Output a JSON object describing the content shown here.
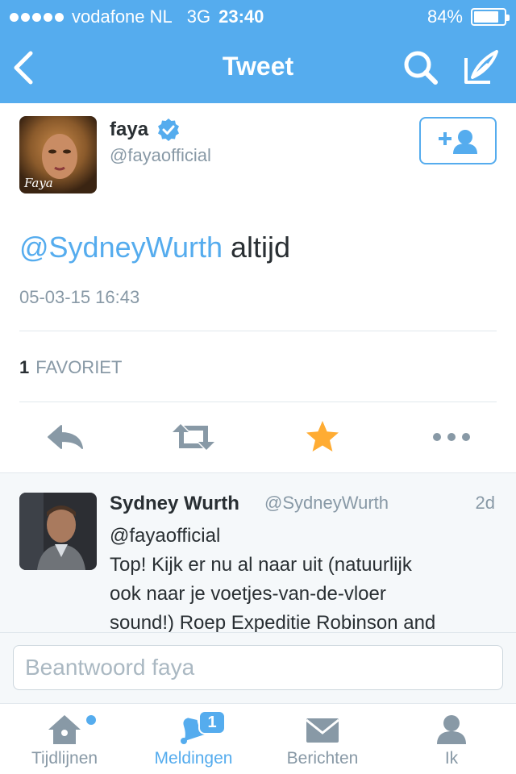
{
  "status_bar": {
    "carrier": "vodafone NL",
    "network": "3G",
    "time": "23:40",
    "battery_percent_label": "84%",
    "battery_level": 0.84
  },
  "nav": {
    "title": "Tweet",
    "icons": [
      "chevron-left-icon",
      "search-icon",
      "compose-icon"
    ]
  },
  "tweet": {
    "author_name": "faya",
    "author_handle": "@fayaofficial",
    "verified": true,
    "mention": "@SydneyWurth",
    "body": "altijd",
    "timestamp": "05-03-15 16:43",
    "favorites_count": "1",
    "favorites_label": "FAVORIET",
    "actions": [
      "reply-icon",
      "retweet-icon",
      "star-icon",
      "more-icon"
    ],
    "avatar_logo": "Faya"
  },
  "reply": {
    "author_name": "Sydney Wurth",
    "author_handle": "@SydneyWurth",
    "time_ago": "2d",
    "text_lines": [
      "@fayaofficial",
      "Top! Kijk er nu al naar uit (natuurlijk",
      "ook naar je voetjes-van-de-vloer",
      "sound!) Roep Expeditie Robinson and"
    ]
  },
  "reply_box": {
    "placeholder": "Beantwoord faya",
    "value": ""
  },
  "tabs": [
    {
      "label": "Tijdlijnen",
      "icon": "home-icon",
      "active": false,
      "dot": true
    },
    {
      "label": "Meldingen",
      "icon": "bell-icon",
      "active": true,
      "badge": "1"
    },
    {
      "label": "Berichten",
      "icon": "envelope-icon",
      "active": false
    },
    {
      "label": "Ik",
      "icon": "person-icon",
      "active": false
    }
  ],
  "colors": {
    "accent": "#55acee",
    "star": "#ffac33",
    "text": "#292f33",
    "muted": "#8899a6",
    "divider": "#e1e8ed"
  }
}
